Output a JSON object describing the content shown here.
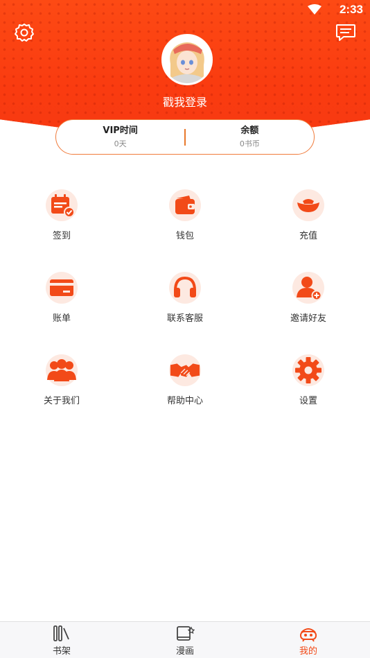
{
  "status_bar": {
    "time": "2:33"
  },
  "header": {
    "login_text": "戳我登录"
  },
  "stats": {
    "vip": {
      "title": "VIP时间",
      "value": "0天"
    },
    "balance": {
      "title": "余额",
      "value": "0书币"
    }
  },
  "menu": [
    {
      "label": "签到",
      "icon": "calendar-check-icon"
    },
    {
      "label": "钱包",
      "icon": "wallet-icon"
    },
    {
      "label": "充值",
      "icon": "gold-ingot-icon"
    },
    {
      "label": "账单",
      "icon": "card-icon"
    },
    {
      "label": "联系客服",
      "icon": "headset-icon"
    },
    {
      "label": "邀请好友",
      "icon": "add-user-icon"
    },
    {
      "label": "关于我们",
      "icon": "team-icon"
    },
    {
      "label": "帮助中心",
      "icon": "handshake-icon"
    },
    {
      "label": "设置",
      "icon": "gear-icon"
    }
  ],
  "tabbar": [
    {
      "label": "书架",
      "icon": "bookshelf-icon"
    },
    {
      "label": "漫画",
      "icon": "comic-book-icon"
    },
    {
      "label": "我的",
      "icon": "mascot-icon",
      "active": true
    }
  ],
  "colors": {
    "accent": "#f24a18",
    "icon_bg": "#fde9e1",
    "header": "#fb3d12"
  }
}
